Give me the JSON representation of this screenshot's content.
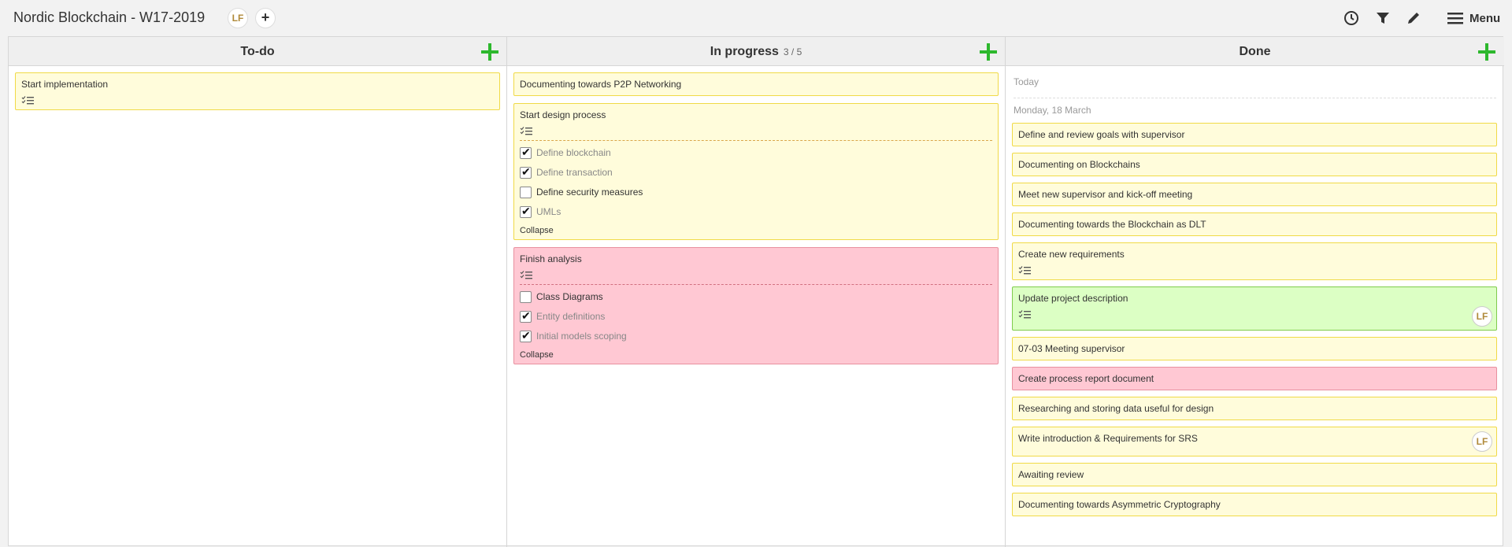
{
  "header": {
    "title": "Nordic Blockchain - W17-2019",
    "member_initials": "LF",
    "add_member": "+",
    "menu_label": "Menu",
    "tools": [
      "history-icon",
      "filter-icon",
      "edit-icon",
      "hamburger-icon"
    ]
  },
  "colors": {
    "yellow_card": "#fffcdb",
    "pink_card": "#ffc8d3",
    "green_card": "#dcffc4",
    "add_green": "#2db82d"
  },
  "columns": {
    "todo": {
      "title": "To-do",
      "cards": [
        {
          "title": "Start implementation",
          "has_checklist": true
        }
      ]
    },
    "inprogress": {
      "title": "In progress",
      "wip": "3 / 5",
      "cards": [
        {
          "title": "Documenting towards P2P Networking"
        },
        {
          "title": "Start design process",
          "items": [
            {
              "label": "Define blockchain",
              "checked": true
            },
            {
              "label": "Define transaction",
              "checked": true
            },
            {
              "label": "Define security measures",
              "checked": false
            },
            {
              "label": "UMLs",
              "checked": true
            }
          ],
          "collapse_label": "Collapse"
        },
        {
          "title": "Finish analysis",
          "color": "pink",
          "items": [
            {
              "label": "Class Diagrams",
              "checked": false
            },
            {
              "label": "Entity definitions",
              "checked": true
            },
            {
              "label": "Initial models scoping",
              "checked": true
            }
          ],
          "collapse_label": "Collapse"
        }
      ]
    },
    "done": {
      "title": "Done",
      "date_today": "Today",
      "date_group": "Monday, 18 March",
      "cards": [
        {
          "title": "Define and review goals with supervisor"
        },
        {
          "title": "Documenting on Blockchains"
        },
        {
          "title": "Meet new supervisor and kick-off meeting"
        },
        {
          "title": "Documenting towards the Blockchain as DLT"
        },
        {
          "title": "Create new requirements",
          "has_checklist": true
        },
        {
          "title": "Update project description",
          "has_checklist": true,
          "color": "green",
          "assignee": "LF"
        },
        {
          "title": "07-03 Meeting supervisor"
        },
        {
          "title": "Create process report document",
          "color": "pink"
        },
        {
          "title": "Researching and storing data useful for design"
        },
        {
          "title": "Write introduction & Requirements for SRS",
          "assignee": "LF"
        },
        {
          "title": "Awaiting review"
        },
        {
          "title": "Documenting towards Asymmetric Cryptography"
        }
      ]
    }
  }
}
